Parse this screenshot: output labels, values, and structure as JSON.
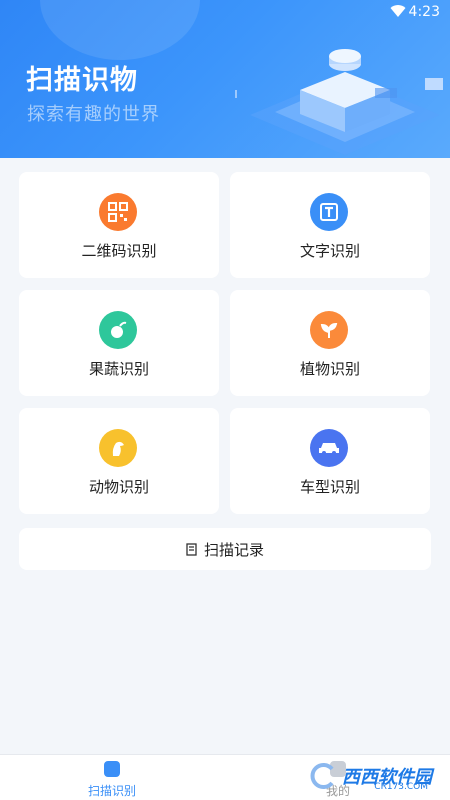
{
  "status_bar": {
    "time": "4:23",
    "wifi_icon": "wifi-icon"
  },
  "banner": {
    "title": "扫描识物",
    "subtitle": "探索有趣的世界"
  },
  "features": [
    {
      "label": "二维码识别",
      "icon": "qrcode-icon",
      "color": "#fa7a2f"
    },
    {
      "label": "文字识别",
      "icon": "text-icon",
      "color": "#3a8ff7"
    },
    {
      "label": "果蔬识别",
      "icon": "vegetable-icon",
      "color": "#2ec79b"
    },
    {
      "label": "植物识别",
      "icon": "plant-icon",
      "color": "#fb8a3a"
    },
    {
      "label": "动物识别",
      "icon": "animal-icon",
      "color": "#f8c12d"
    },
    {
      "label": "车型识别",
      "icon": "car-icon",
      "color": "#4a74f0"
    }
  ],
  "record": {
    "label": "扫描记录",
    "icon": "record-icon"
  },
  "bottom_nav": {
    "tabs": [
      {
        "label": "扫描识别",
        "icon": "scan-tab-icon",
        "active": true
      },
      {
        "label": "我的",
        "icon": "mine-tab-icon",
        "active": false
      }
    ]
  },
  "watermark": {
    "text": "西西软件园",
    "sub": "CR173.COM"
  },
  "colors": {
    "accent": "#3a8ff7",
    "banner": "#2f86f6",
    "background": "#f3f6fa"
  }
}
